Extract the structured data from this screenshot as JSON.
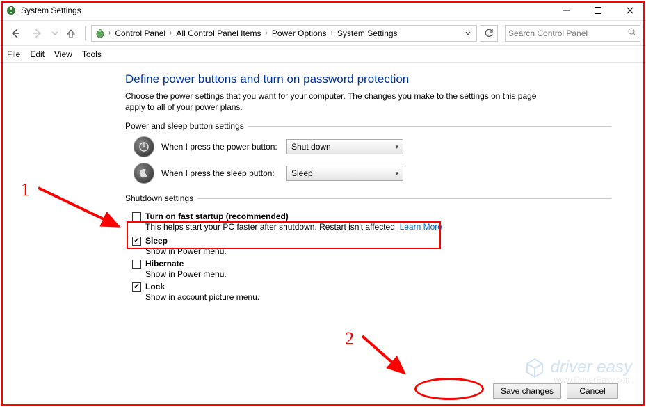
{
  "window": {
    "title": "System Settings"
  },
  "breadcrumbs": {
    "items": [
      "Control Panel",
      "All Control Panel Items",
      "Power Options",
      "System Settings"
    ]
  },
  "search": {
    "placeholder": "Search Control Panel"
  },
  "menu": {
    "file": "File",
    "edit": "Edit",
    "view": "View",
    "tools": "Tools"
  },
  "page": {
    "title": "Define power buttons and turn on password protection",
    "description": "Choose the power settings that you want for your computer. The changes you make to the settings on this page apply to all of your power plans."
  },
  "section_power_sleep": {
    "header": "Power and sleep button settings",
    "power_label": "When I press the power button:",
    "power_value": "Shut down",
    "sleep_label": "When I press the sleep button:",
    "sleep_value": "Sleep"
  },
  "section_shutdown": {
    "header": "Shutdown settings",
    "fast_startup": {
      "label": "Turn on fast startup (recommended)",
      "desc": "This helps start your PC faster after shutdown. Restart isn't affected.",
      "link": "Learn More",
      "checked": false
    },
    "sleep": {
      "label": "Sleep",
      "desc": "Show in Power menu.",
      "checked": true
    },
    "hibernate": {
      "label": "Hibernate",
      "desc": "Show in Power menu.",
      "checked": false
    },
    "lock": {
      "label": "Lock",
      "desc": "Show in account picture menu.",
      "checked": true
    }
  },
  "footer": {
    "save": "Save changes",
    "cancel": "Cancel"
  },
  "annotations": {
    "num1": "1",
    "num2": "2"
  },
  "watermark": {
    "brand": "driver easy",
    "url": "www.DriverEasy.com"
  }
}
